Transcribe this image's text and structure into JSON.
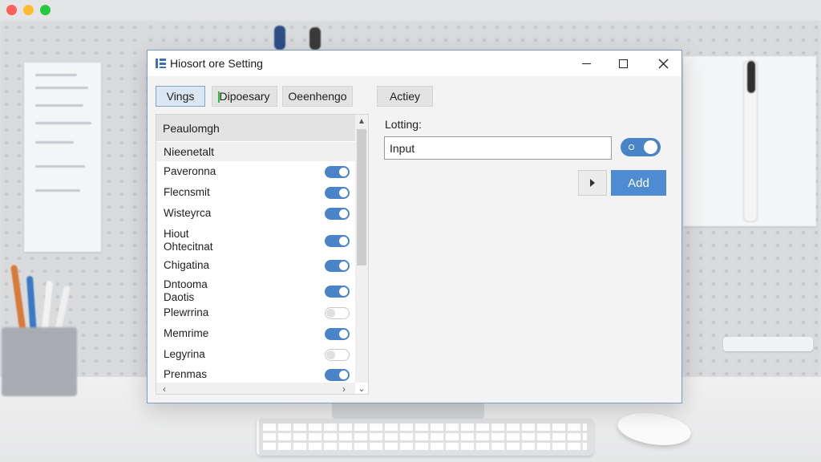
{
  "window": {
    "title": "Hiosort ore Setting"
  },
  "tabs": [
    {
      "label": "Vings",
      "active": true
    },
    {
      "label": "Dipoesary",
      "active": false
    },
    {
      "label": "Oeenhengo",
      "active": false
    },
    {
      "label": "Actiey",
      "active": false
    }
  ],
  "list": {
    "header": "Peaulomgh",
    "subheader": "Nieenetalt",
    "items": [
      {
        "label": "Paveronna",
        "enabled": true
      },
      {
        "label": "Flecnsmit",
        "enabled": true
      },
      {
        "label": "Wisteyrca",
        "enabled": true
      },
      {
        "label": "Hiout\nOhtecitnat",
        "enabled": true
      },
      {
        "label": "Chigatina",
        "enabled": true
      },
      {
        "label": "Dntooma\nDaotis",
        "enabled": true
      },
      {
        "label": "Plewrrina",
        "enabled": false
      },
      {
        "label": "Memrime",
        "enabled": true
      },
      {
        "label": "Legyrina",
        "enabled": false
      },
      {
        "label": "Prenmas",
        "enabled": true
      }
    ]
  },
  "setting": {
    "label": "Lotting:",
    "input_value": "Input",
    "toggle_enabled": true,
    "add_button": "Add"
  },
  "colors": {
    "accent": "#4a84c8",
    "add_button": "#4f8bd0",
    "window_border": "#7a9cc9"
  }
}
